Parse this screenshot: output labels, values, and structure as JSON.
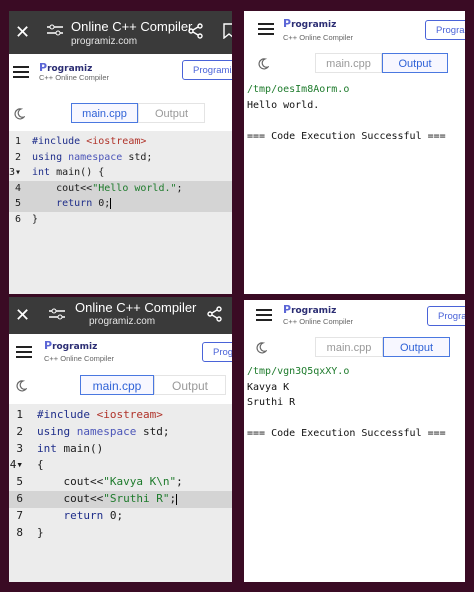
{
  "browser": {
    "title": "Online C++ Compiler",
    "url": "programiz.com",
    "close_icon": "close-icon",
    "tune_icon": "tune-icon",
    "share_icon": "share-icon"
  },
  "site": {
    "logo_text": "rogramiz",
    "logo_p": "P",
    "subtitle": "C++ Online Compiler",
    "programiz_button": "Programiz",
    "programiz_button_short": "Prog"
  },
  "tabs": {
    "code": "main.cpp",
    "output": "Output"
  },
  "panel1": {
    "lines": [
      {
        "n": "1",
        "parts": [
          [
            "kw",
            "#include "
          ],
          [
            "inc",
            "<iostream>"
          ]
        ]
      },
      {
        "n": "2",
        "parts": [
          [
            "kw",
            "using "
          ],
          [
            "nm",
            "namespace "
          ],
          [
            "plain",
            "std;"
          ]
        ]
      },
      {
        "n": "3",
        "parts": [
          [
            "kw",
            "int "
          ],
          [
            "plain",
            "main() {"
          ]
        ]
      },
      {
        "n": "4",
        "parts": [
          [
            "plain",
            "    cout<<"
          ],
          [
            "str",
            "\"Hello world.\""
          ],
          [
            "plain",
            ";"
          ]
        ]
      },
      {
        "n": "5",
        "parts": [
          [
            "plain",
            "    "
          ],
          [
            "kw",
            "return "
          ],
          [
            "plain",
            "0;"
          ]
        ]
      },
      {
        "n": "6",
        "parts": [
          [
            "plain",
            "}"
          ]
        ]
      }
    ]
  },
  "panel2": {
    "path": "/tmp/oesIm8Aorm.o",
    "output_lines": [
      "Hello world.",
      "",
      "=== Code Execution Successful ==="
    ]
  },
  "panel3": {
    "lines": [
      {
        "n": "1",
        "parts": [
          [
            "kw",
            "#include "
          ],
          [
            "inc",
            "<iostream>"
          ]
        ]
      },
      {
        "n": "2",
        "parts": [
          [
            "kw",
            "using "
          ],
          [
            "nm",
            "namespace "
          ],
          [
            "plain",
            "std;"
          ]
        ]
      },
      {
        "n": "3",
        "parts": [
          [
            "kw",
            "int "
          ],
          [
            "plain",
            "main()"
          ]
        ]
      },
      {
        "n": "4",
        "parts": [
          [
            "plain",
            "{"
          ]
        ]
      },
      {
        "n": "5",
        "parts": [
          [
            "plain",
            "    cout<<"
          ],
          [
            "str",
            "\"Kavya K\\n\""
          ],
          [
            "plain",
            ";"
          ]
        ]
      },
      {
        "n": "6",
        "parts": [
          [
            "plain",
            "    cout<<"
          ],
          [
            "str",
            "\"Sruthi R\""
          ],
          [
            "plain",
            ";"
          ]
        ]
      },
      {
        "n": "7",
        "parts": [
          [
            "plain",
            "    "
          ],
          [
            "kw",
            "return "
          ],
          [
            "plain",
            "0;"
          ]
        ]
      },
      {
        "n": "8",
        "parts": [
          [
            "plain",
            "}"
          ]
        ]
      }
    ]
  },
  "panel4": {
    "path": "/tmp/vgn3Q5qxXY.o",
    "output_lines": [
      "Kavya K",
      "Sruthi R",
      "",
      "=== Code Execution Successful ==="
    ]
  },
  "colors": {
    "frame": "#3a0b24",
    "accent": "#4a63d8",
    "string": "#1e7b2c"
  }
}
